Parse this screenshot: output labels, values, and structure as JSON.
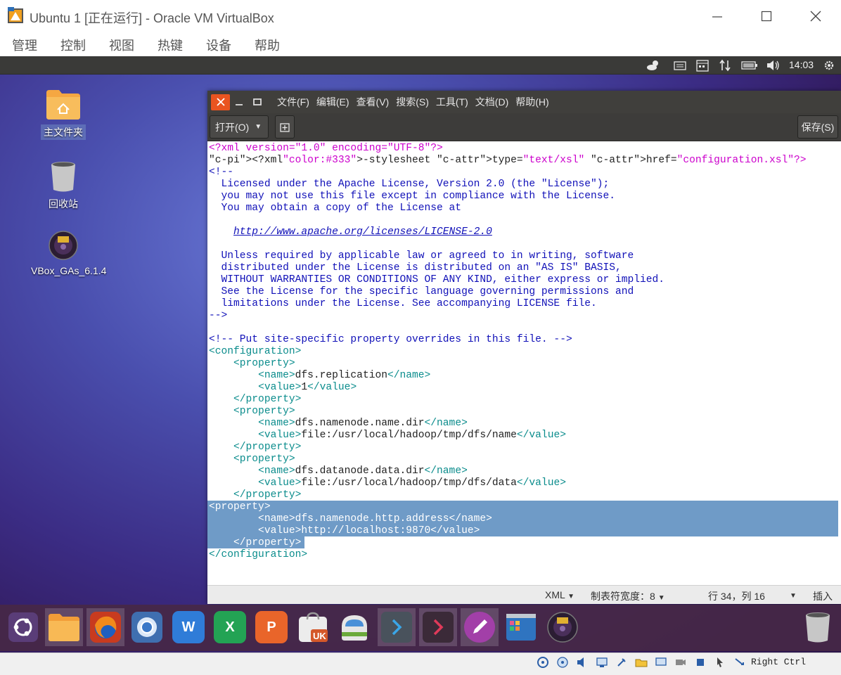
{
  "host": {
    "window_title": "Ubuntu 1 [正在运行] - Oracle VM VirtualBox",
    "menu": [
      "管理",
      "控制",
      "视图",
      "热键",
      "设备",
      "帮助"
    ],
    "host_key": "Right Ctrl"
  },
  "guest": {
    "clock": "14:03",
    "desktop_icons": [
      {
        "label": "主文件夹",
        "icon": "home-folder-icon"
      },
      {
        "label": "回收站",
        "icon": "trash-icon"
      },
      {
        "label": "VBox_GAs_6.1.4",
        "icon": "cd-icon"
      }
    ],
    "dock_apps": [
      "ubuntu-launcher",
      "files",
      "firefox",
      "chromium",
      "wps-writer",
      "wps-spreadsheets",
      "wps-presentation",
      "ukylin-store",
      "software-center",
      "terminal",
      "terminal-2",
      "text-editor",
      "settings-manager",
      "cd-drive",
      "trash"
    ]
  },
  "editor": {
    "menu": [
      "文件(F)",
      "编辑(E)",
      "查看(V)",
      "搜索(S)",
      "工具(T)",
      "文档(D)",
      "帮助(H)"
    ],
    "open_label": "打开(O)",
    "save_label": "保存(S)",
    "status": {
      "lang": "XML",
      "tab_width": "制表符宽度：8",
      "position": "行 34，列 16",
      "insert_mode": "插入"
    },
    "lines": [
      "<?xml version=\"1.0\" encoding=\"UTF-8\"?>",
      "<?xml-stylesheet type=\"text/xsl\" href=\"configuration.xsl\"?>",
      "<!--",
      "  Licensed under the Apache License, Version 2.0 (the \"License\");",
      "  you may not use this file except in compliance with the License.",
      "  You may obtain a copy of the License at",
      "",
      "    http://www.apache.org/licenses/LICENSE-2.0",
      "",
      "  Unless required by applicable law or agreed to in writing, software",
      "  distributed under the License is distributed on an \"AS IS\" BASIS,",
      "  WITHOUT WARRANTIES OR CONDITIONS OF ANY KIND, either express or implied.",
      "  See the License for the specific language governing permissions and",
      "  limitations under the License. See accompanying LICENSE file.",
      "-->",
      "",
      "<!-- Put site-specific property overrides in this file. -->",
      "<configuration>",
      "    <property>",
      "        <name>dfs.replication</name>",
      "        <value>1</value>",
      "    </property>",
      "    <property>",
      "        <name>dfs.namenode.name.dir</name>",
      "        <value>file:/usr/local/hadoop/tmp/dfs/name</value>",
      "    </property>",
      "    <property>",
      "        <name>dfs.datanode.data.dir</name>",
      "        <value>file:/usr/local/hadoop/tmp/dfs/data</value>",
      "    </property>",
      "<property>",
      "        <name>dfs.namenode.http.address</name>",
      "        <value>http://localhost:9870</value>",
      "    </property>",
      "</configuration>"
    ]
  }
}
